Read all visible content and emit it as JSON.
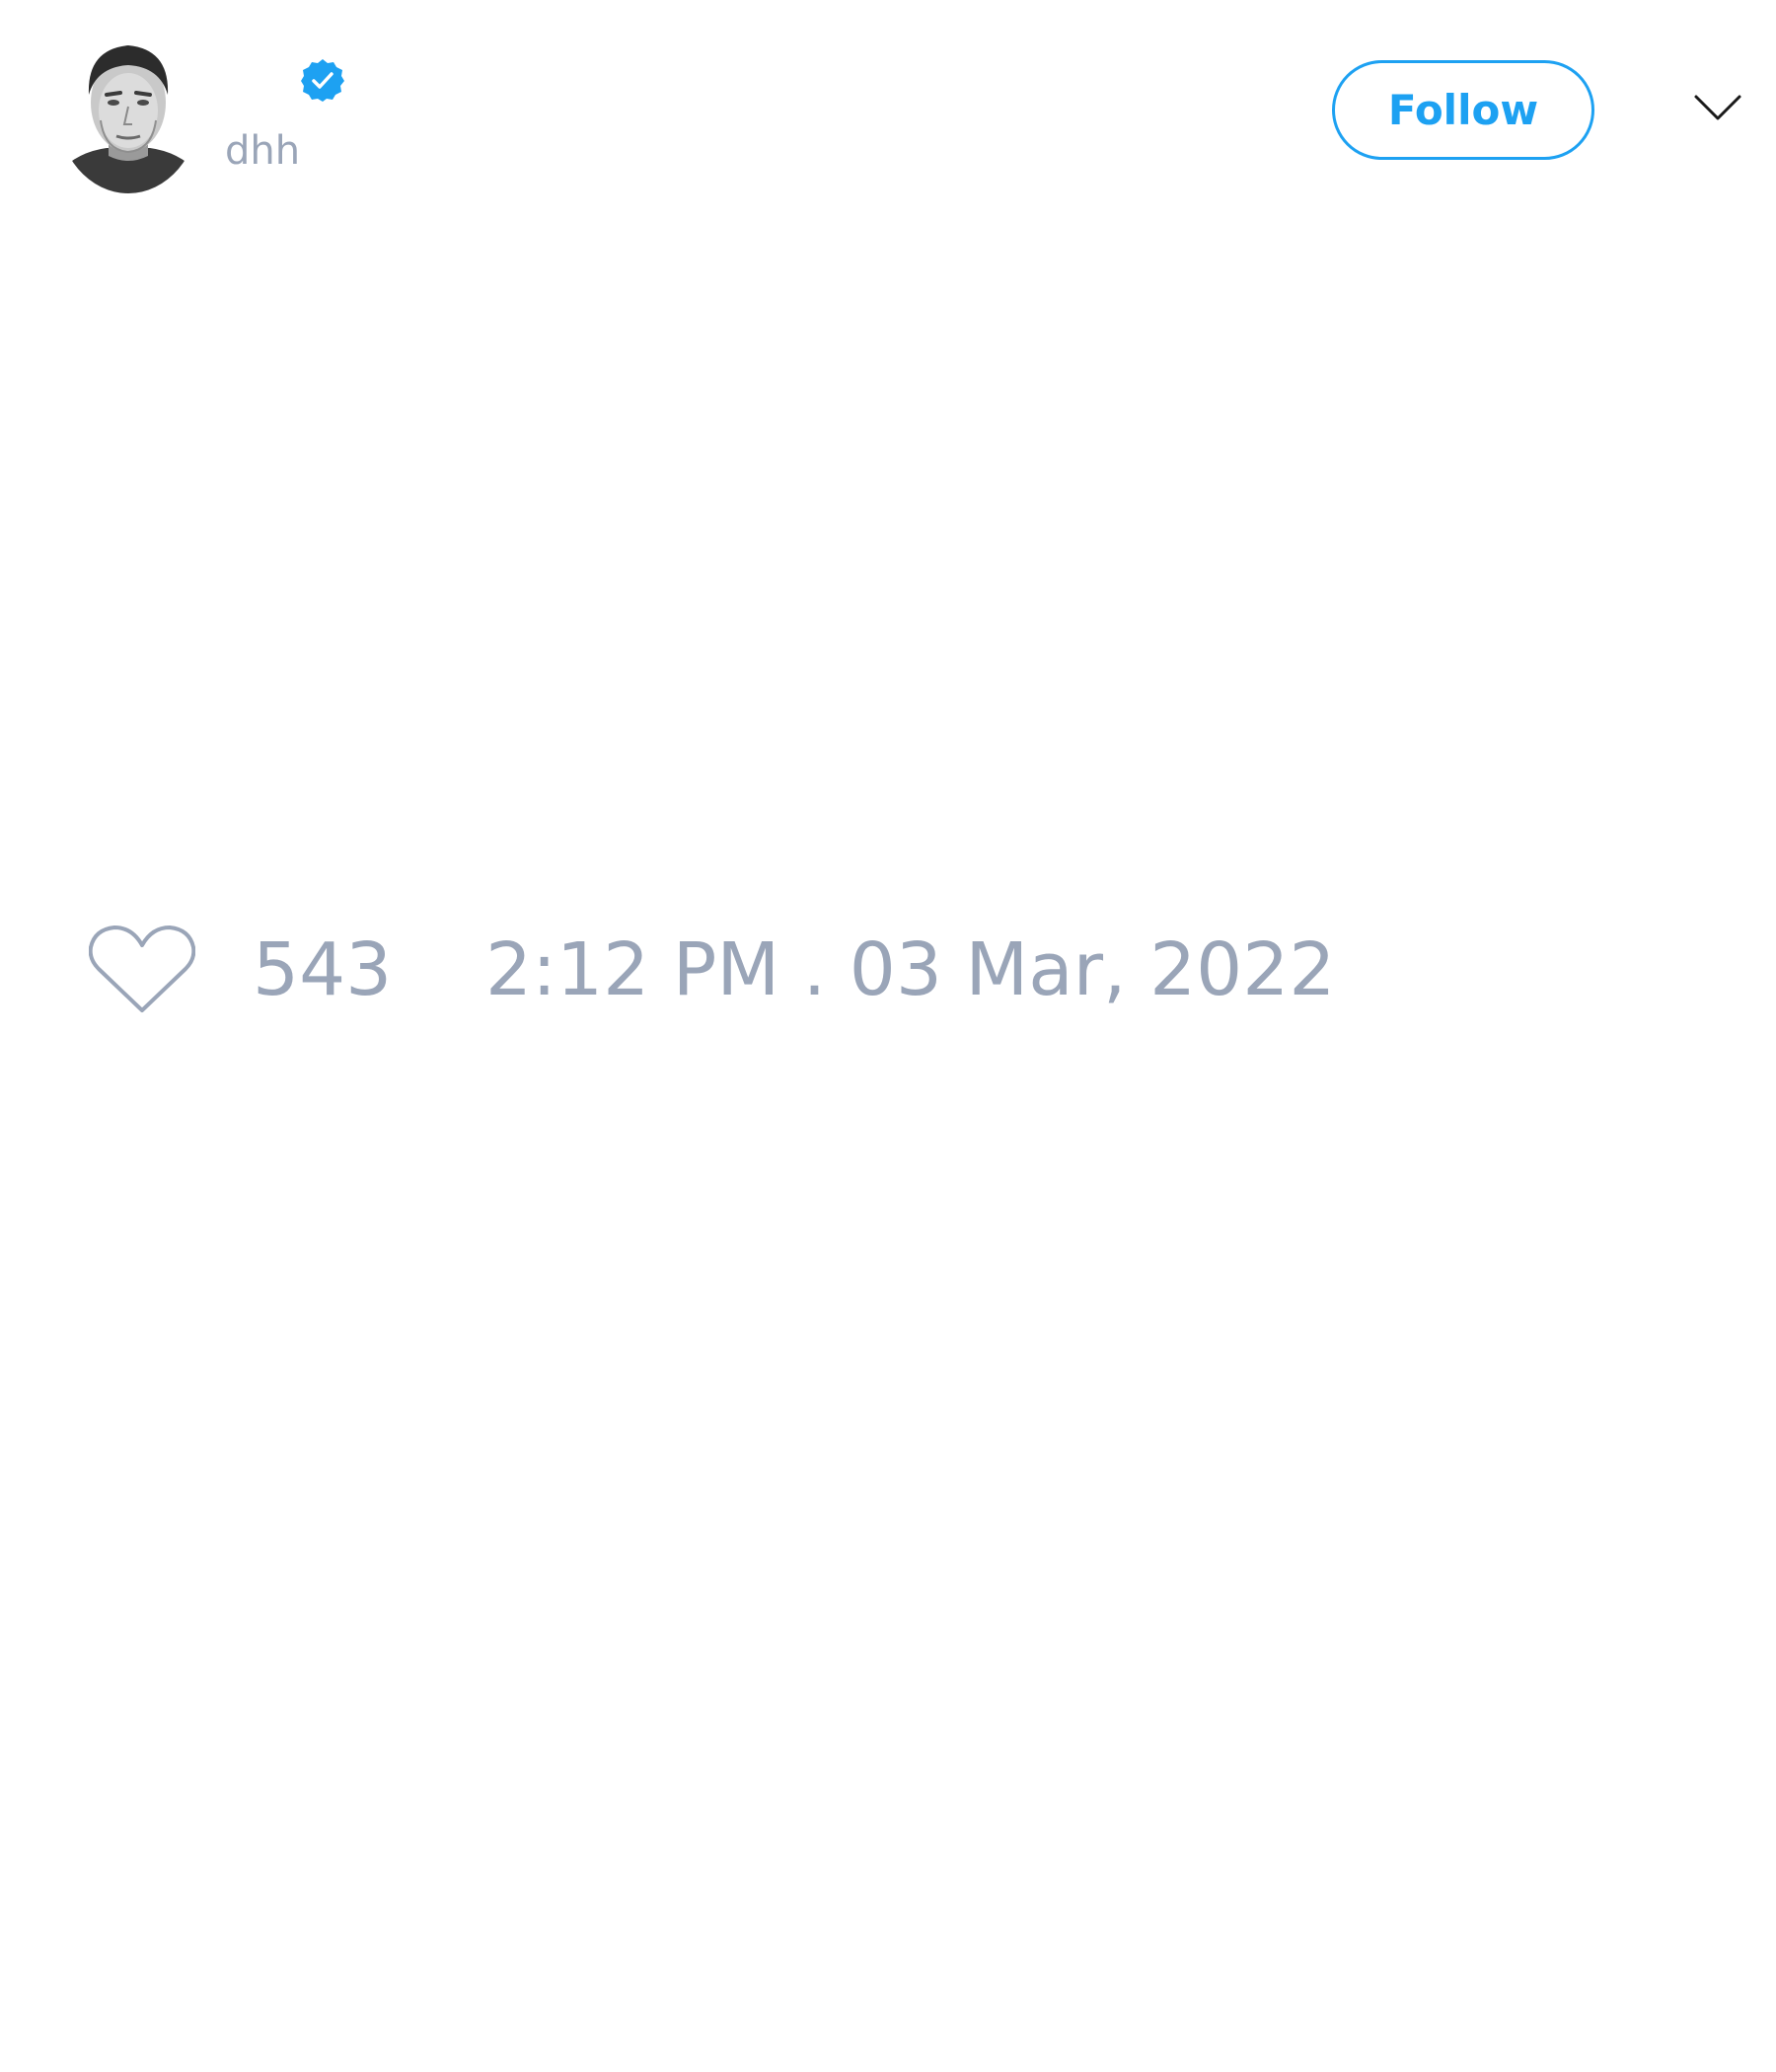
{
  "tweet": {
    "author": {
      "handle": "dhh",
      "verified": true,
      "avatar": "grayscale-portrait-photo"
    },
    "follow_label": "Follow",
    "menu_icon": "chevron-down-icon",
    "likes": {
      "icon": "heart-icon",
      "count": "543"
    },
    "timestamp": "2:12 PM . 03 Mar, 2022"
  },
  "colors": {
    "accent": "#1da1f2",
    "muted_text": "#9aa5b8",
    "background": "#ffffff"
  }
}
